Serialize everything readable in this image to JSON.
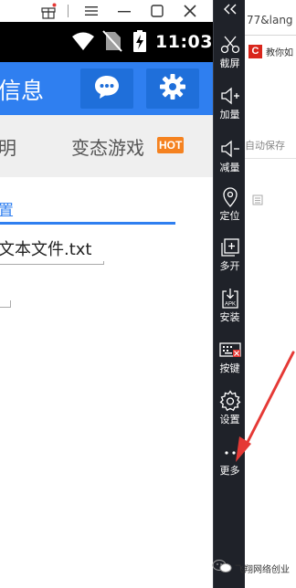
{
  "emulator": {
    "status_bar": {
      "time": "11:03"
    },
    "app_bar": {
      "title": "信息"
    },
    "tabs": {
      "left_partial": "明",
      "games": "变态游戏",
      "hot_badge": "HOT"
    },
    "content": {
      "link_text": "置",
      "file_name": "文本文件.txt"
    }
  },
  "toolbar": {
    "items": [
      {
        "label": "截屏",
        "icon": "scissors-icon"
      },
      {
        "label": "加量",
        "icon": "volume-up-icon"
      },
      {
        "label": "减量",
        "icon": "volume-down-icon"
      },
      {
        "label": "定位",
        "icon": "location-pin-icon"
      },
      {
        "label": "多开",
        "icon": "multi-window-icon"
      },
      {
        "label": "安装",
        "icon": "apk-install-icon"
      },
      {
        "label": "按键",
        "icon": "keyboard-icon"
      },
      {
        "label": "设置",
        "icon": "gear-icon"
      },
      {
        "label": "更多",
        "icon": "more-dots-icon"
      }
    ]
  },
  "browser": {
    "url_partial": "77&lang",
    "tab_logo": "C",
    "tab_text": "教你如",
    "autosave": "自动保存",
    "watermark": "飞翔网络创业"
  },
  "colors": {
    "accent_blue": "#2f7ff0",
    "toolbar_bg": "#1f2229",
    "hot_orange": "#f58220",
    "annotation_red": "#e53935"
  }
}
